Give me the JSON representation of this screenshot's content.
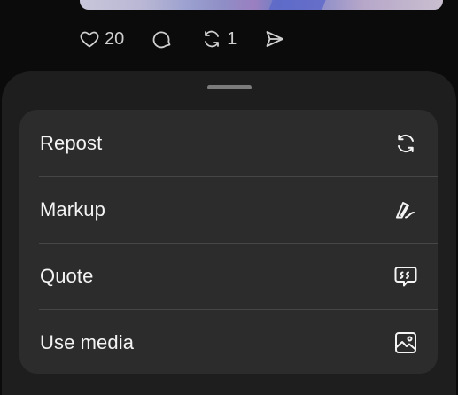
{
  "post": {
    "actions": {
      "like": {
        "icon": "heart-icon",
        "count": "20"
      },
      "comment": {
        "icon": "comment-icon"
      },
      "repost": {
        "icon": "repost-icon",
        "count": "1"
      },
      "share": {
        "icon": "send-icon"
      }
    }
  },
  "sheet": {
    "items": [
      {
        "label": "Repost",
        "icon": "repost-icon"
      },
      {
        "label": "Markup",
        "icon": "markup-pen-icon"
      },
      {
        "label": "Quote",
        "icon": "quote-bubble-icon"
      },
      {
        "label": "Use media",
        "icon": "image-icon"
      }
    ]
  },
  "colors": {
    "background": "#0b0b0b",
    "sheet": "#1e1e1e",
    "menu": "#2c2c2c",
    "text": "#f4f4f4",
    "muted": "#cfcfcf"
  }
}
